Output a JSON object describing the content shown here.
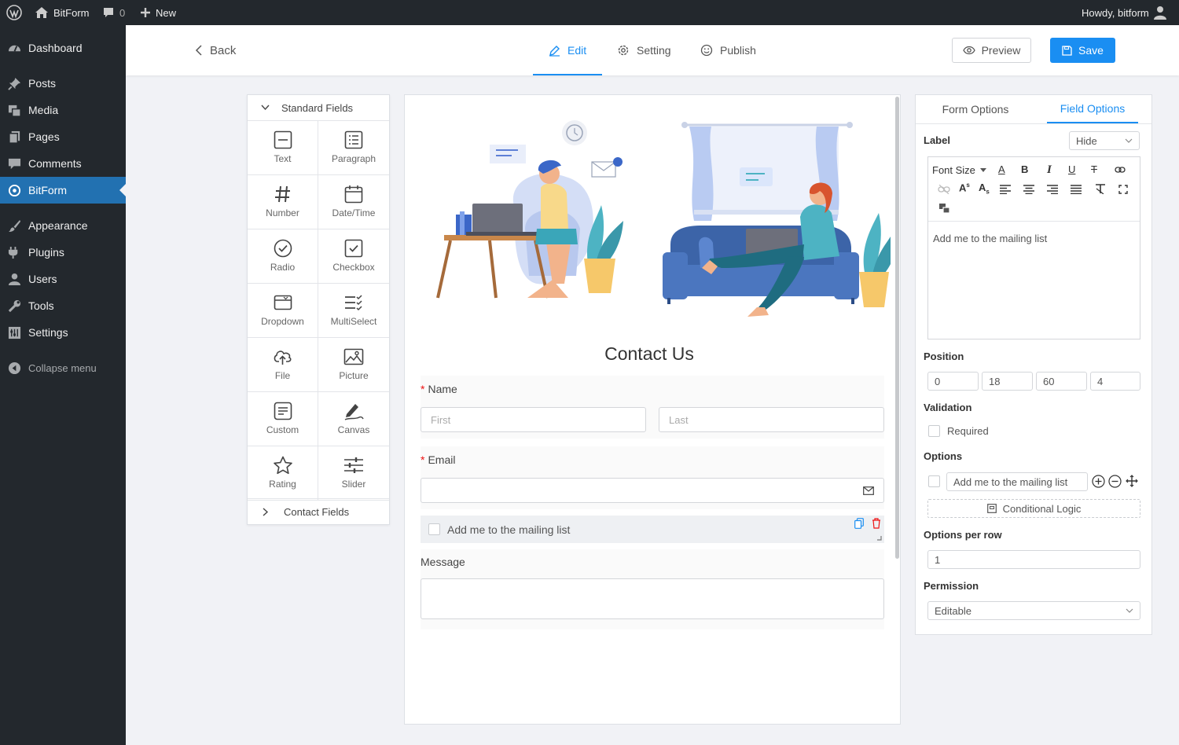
{
  "adminbar": {
    "site_name": "BitForm",
    "comments_count": "0",
    "new_label": "New",
    "howdy": "Howdy, bitform"
  },
  "sidebar": {
    "items": [
      {
        "label": "Dashboard",
        "icon": "dashboard-icon"
      },
      {
        "label": "Posts",
        "icon": "pin-icon"
      },
      {
        "label": "Media",
        "icon": "media-icon"
      },
      {
        "label": "Pages",
        "icon": "pages-icon"
      },
      {
        "label": "Comments",
        "icon": "comment-icon"
      },
      {
        "label": "BitForm",
        "icon": "bitform-icon",
        "active": true
      },
      {
        "label": "Appearance",
        "icon": "brush-icon"
      },
      {
        "label": "Plugins",
        "icon": "plugin-icon"
      },
      {
        "label": "Users",
        "icon": "user-icon"
      },
      {
        "label": "Tools",
        "icon": "wrench-icon"
      },
      {
        "label": "Settings",
        "icon": "settings-icon"
      }
    ],
    "collapse_label": "Collapse menu"
  },
  "topbar": {
    "back_label": "Back",
    "tabs": [
      {
        "label": "Edit",
        "icon": "pencil-icon",
        "active": true
      },
      {
        "label": "Setting",
        "icon": "gear-icon"
      },
      {
        "label": "Publish",
        "icon": "smile-icon"
      }
    ],
    "preview_label": "Preview",
    "save_label": "Save"
  },
  "fields_panel": {
    "standard_header": "Standard Fields",
    "contact_header": "Contact Fields",
    "fields": [
      {
        "label": "Text",
        "icon": "text-field-icon"
      },
      {
        "label": "Paragraph",
        "icon": "paragraph-icon"
      },
      {
        "label": "Number",
        "icon": "hash-icon"
      },
      {
        "label": "Date/Time",
        "icon": "calendar-icon"
      },
      {
        "label": "Radio",
        "icon": "radio-check-icon"
      },
      {
        "label": "Checkbox",
        "icon": "checkbox-icon"
      },
      {
        "label": "Dropdown",
        "icon": "dropdown-icon"
      },
      {
        "label": "MultiSelect",
        "icon": "multiselect-icon"
      },
      {
        "label": "File",
        "icon": "upload-cloud-icon"
      },
      {
        "label": "Picture",
        "icon": "picture-icon"
      },
      {
        "label": "Custom",
        "icon": "custom-icon"
      },
      {
        "label": "Canvas",
        "icon": "pen-icon"
      },
      {
        "label": "Rating",
        "icon": "star-icon"
      },
      {
        "label": "Slider",
        "icon": "slider-icon"
      }
    ]
  },
  "form": {
    "title": "Contact Us",
    "name_label": "Name",
    "first_placeholder": "First",
    "last_placeholder": "Last",
    "email_label": "Email",
    "checkbox_label": "Add me to the mailing list",
    "message_label": "Message"
  },
  "properties": {
    "tabs": [
      {
        "label": "Form Options"
      },
      {
        "label": "Field Options",
        "active": true
      }
    ],
    "label_heading": "Label",
    "label_select": "Hide",
    "font_size_label": "Font Size",
    "editor_content": "Add me to the mailing list",
    "position_heading": "Position",
    "position_values": [
      "0",
      "18",
      "60",
      "4"
    ],
    "validation_heading": "Validation",
    "required_label": "Required",
    "options_heading": "Options",
    "option_value": "Add me to the mailing list",
    "conditional_logic_label": "Conditional Logic",
    "options_per_row_heading": "Options per row",
    "options_per_row_value": "1",
    "permission_heading": "Permission",
    "permission_value": "Editable"
  },
  "colors": {
    "accent": "#1a8ef2",
    "wp_dark": "#23282d",
    "wp_active": "#2271b1",
    "required": "#e11111"
  }
}
